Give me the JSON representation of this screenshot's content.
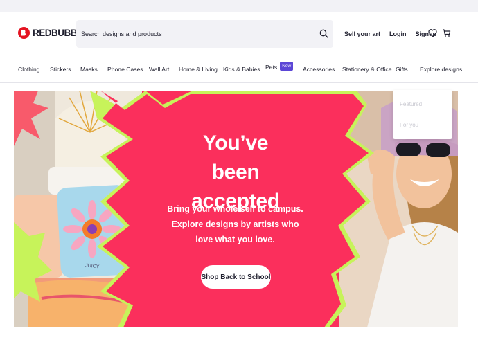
{
  "brand": {
    "name": "REDBUBBLE",
    "color": "#e41321"
  },
  "search": {
    "placeholder": "Search designs and products"
  },
  "header_links": {
    "sell": "Sell your art",
    "login": "Login",
    "signup": "Signup"
  },
  "icons": [
    "search-icon",
    "heart-icon",
    "cart-icon"
  ],
  "nav": {
    "items": [
      "Clothing",
      "Stickers",
      "Masks",
      "Phone Cases",
      "Wall Art",
      "Home & Living",
      "Kids & Babies",
      "Pets",
      "Accessories",
      "Stationery & Office",
      "Gifts",
      "Explore designs"
    ],
    "new_badge": "New"
  },
  "dropdown": {
    "items": [
      "Featured",
      "For you"
    ]
  },
  "banner": {
    "headline": "You’ve been accepted",
    "subtext": "Bring your whole self to campus. Explore designs by artists who love what you love.",
    "cta": "Shop Back to School",
    "pillow_text": "JUICY",
    "colors": {
      "background": "#fb2f5c",
      "accent": "#c7f35a"
    }
  }
}
